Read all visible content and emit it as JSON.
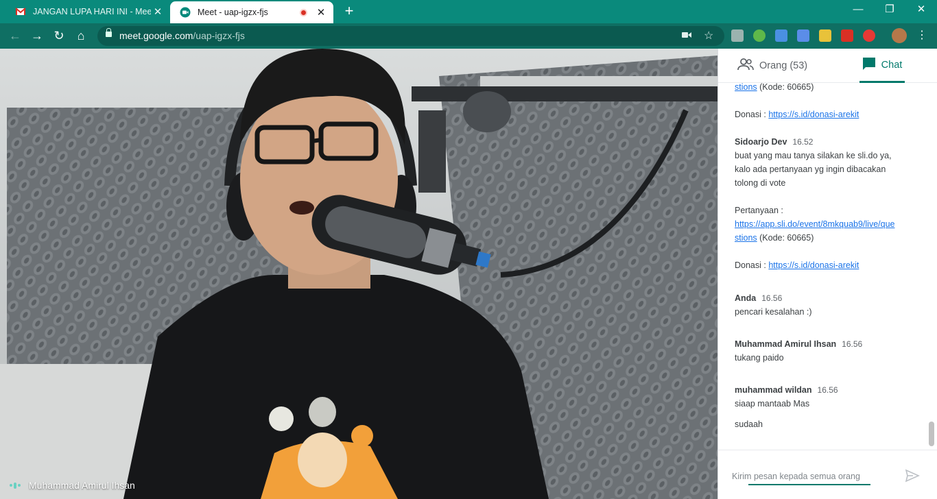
{
  "browser": {
    "tabs": [
      {
        "title": "JANGAN LUPA HARI INI - Meetup",
        "favicon": "gmail-icon",
        "active": false
      },
      {
        "title": "Meet - uap-igzx-fjs",
        "favicon": "meet-icon",
        "active": true,
        "recording": true
      }
    ],
    "url_host": "meet.google.com",
    "url_path": "/uap-igzx-fjs",
    "accent_color": "#0a8a7c"
  },
  "video": {
    "speaker_name": "Muhammad Amirul Ihsan"
  },
  "panel": {
    "tabs": {
      "people": "Orang (53)",
      "chat": "Chat"
    },
    "messages": [
      {
        "type": "cont",
        "link": "stions",
        "after": " (Kode: 60665)"
      },
      {
        "type": "cont",
        "before": "Donasi : ",
        "link": "https://s.id/donasi-arekit"
      },
      {
        "type": "head",
        "sender": "Sidoarjo Dev",
        "time": "16.52"
      },
      {
        "type": "text",
        "lines": [
          "buat yang mau tanya silakan ke sli.do ya,",
          "kalo ada pertanyaan yg ingin dibacakan",
          "tolong di vote"
        ]
      },
      {
        "type": "text",
        "lines": [
          "Pertanyaan :"
        ]
      },
      {
        "type": "link",
        "link1": "https://app.sli.do/event/8mkquab9/live/que",
        "link2": "stions",
        "after": " (Kode: 60665)"
      },
      {
        "type": "cont",
        "before": "Donasi : ",
        "link": "https://s.id/donasi-arekit"
      },
      {
        "type": "head",
        "sender": "Anda",
        "time": "16.56",
        "text": "pencari kesalahan :)"
      },
      {
        "type": "head",
        "sender": "Muhammad Amirul Ihsan",
        "time": "16.56",
        "text": "tukang paido"
      },
      {
        "type": "head",
        "sender": "muhammad wildan",
        "time": "16.56",
        "text": "siaap mantaab Mas",
        "extra": "sudaah"
      }
    ],
    "composer_placeholder": "Kirim pesan kepada semua orang"
  }
}
